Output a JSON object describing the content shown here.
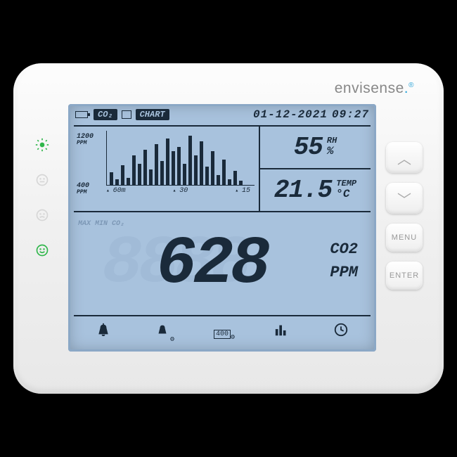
{
  "brand": {
    "name": "envisense",
    "reg": "®"
  },
  "status": {
    "sun": "☀",
    "face_neutral": "☺",
    "face_sad": "☹",
    "face_happy": "☺"
  },
  "header": {
    "co2_label": "CO₂",
    "chart_label": "CHART",
    "date": "01-12-2021",
    "time": "09:27"
  },
  "chart_data": {
    "type": "bar",
    "y_top": "1200",
    "y_top_unit": "PPM",
    "y_bot": "400",
    "y_bot_unit": "PPM",
    "x_ticks": [
      "60m",
      "30",
      "15"
    ],
    "values": [
      18,
      8,
      28,
      10,
      42,
      30,
      50,
      22,
      58,
      34,
      66,
      48,
      54,
      30,
      70,
      42,
      62,
      26,
      48,
      14,
      36,
      8,
      20,
      6
    ]
  },
  "rh": {
    "value": "55",
    "unit": "%",
    "label": "RH"
  },
  "temp": {
    "value": "21.5",
    "unit": "°C",
    "label": "TEMP"
  },
  "co2": {
    "minmax": "MAX\nMIN\nCO₂",
    "value": "628",
    "label1": "CO2",
    "label2": "PPM",
    "foot": ""
  },
  "footer_icons": {
    "alarm": "alarm-icon",
    "alarm_set": "alarm-settings-icon",
    "threshold": "400",
    "chart": "chart-icon",
    "clock": "clock-icon"
  },
  "buttons": {
    "up": "︿",
    "down": "﹀",
    "menu": "MENU",
    "enter": "ENTER"
  }
}
